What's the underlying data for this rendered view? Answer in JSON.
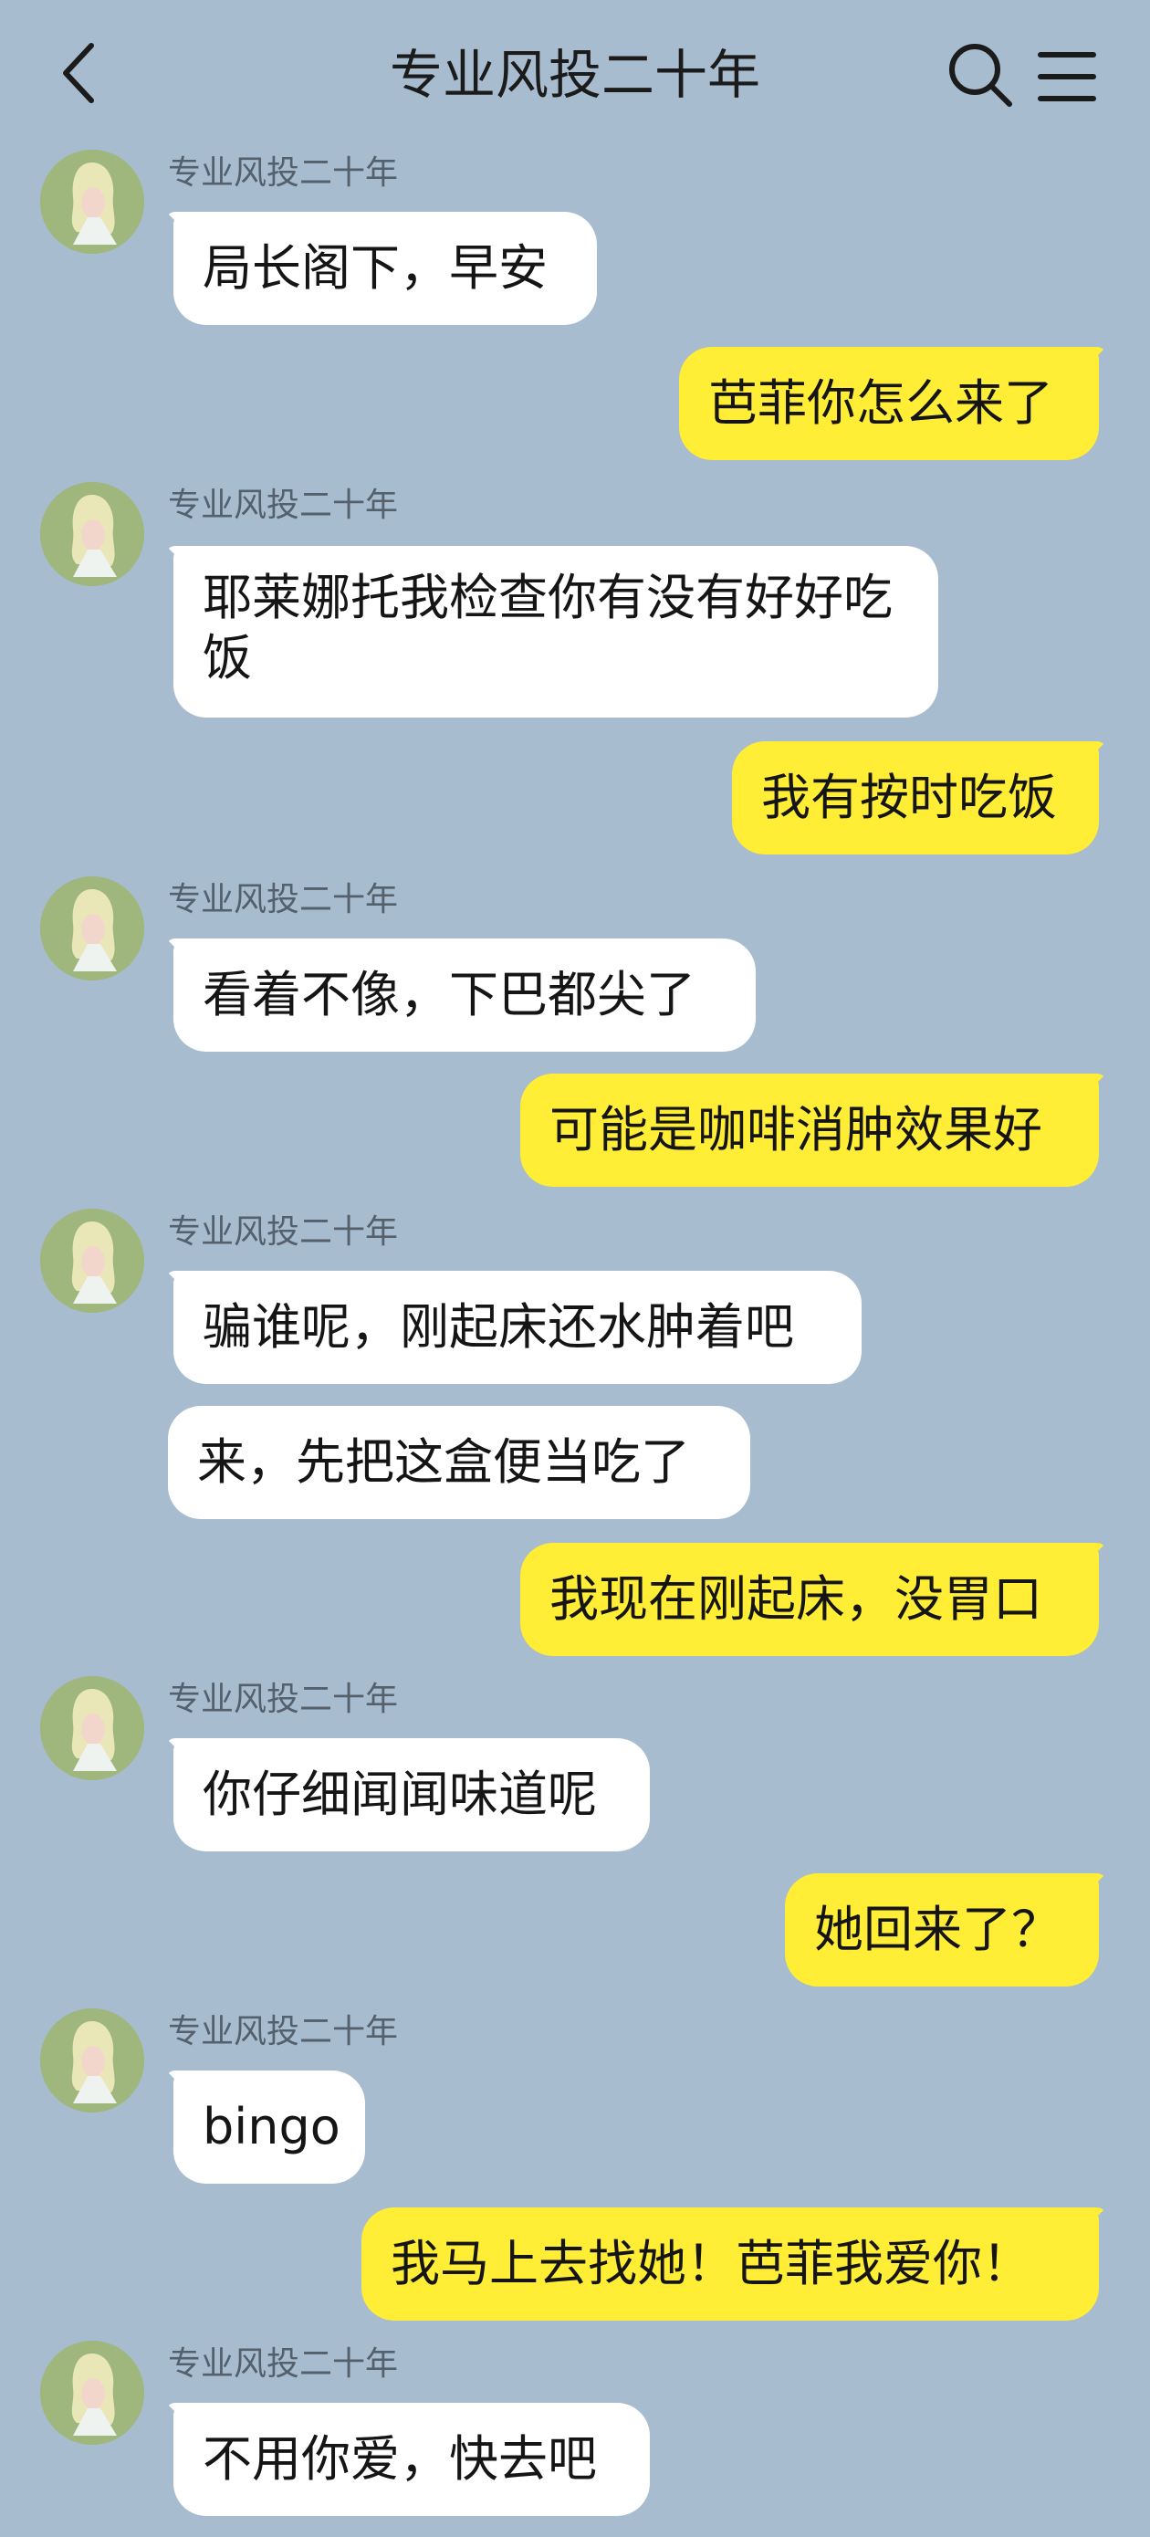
{
  "header": {
    "title": "专业风投二十年",
    "back_icon": "chevron-left-icon",
    "search_icon": "search-icon",
    "menu_icon": "menu-icon"
  },
  "colors": {
    "background": "#a7bccf",
    "incoming_bubble": "#ffffff",
    "outgoing_bubble": "#ffed36"
  },
  "contact": {
    "name": "专业风投二十年"
  },
  "messages": [
    {
      "side": "in",
      "sender": "专业风投二十年",
      "text": "局长阁下，早安"
    },
    {
      "side": "out",
      "text": "芭菲你怎么来了"
    },
    {
      "side": "in",
      "sender": "专业风投二十年",
      "text": "耶莱娜托我检查你有没有好好吃饭"
    },
    {
      "side": "out",
      "text": "我有按时吃饭"
    },
    {
      "side": "in",
      "sender": "专业风投二十年",
      "text": "看着不像，下巴都尖了"
    },
    {
      "side": "out",
      "text": "可能是咖啡消肿效果好"
    },
    {
      "side": "in",
      "sender": "专业风投二十年",
      "text": "骗谁呢，刚起床还水肿着吧"
    },
    {
      "side": "in",
      "text": "来，先把这盒便当吃了"
    },
    {
      "side": "out",
      "text": "我现在刚起床，没胃口"
    },
    {
      "side": "in",
      "sender": "专业风投二十年",
      "text": "你仔细闻闻味道呢"
    },
    {
      "side": "out",
      "text": "她回来了？"
    },
    {
      "side": "in",
      "sender": "专业风投二十年",
      "text": "bingo"
    },
    {
      "side": "out",
      "text": "我马上去找她！芭菲我爱你！"
    },
    {
      "side": "in",
      "sender": "专业风投二十年",
      "text": "不用你爱，快去吧"
    }
  ]
}
